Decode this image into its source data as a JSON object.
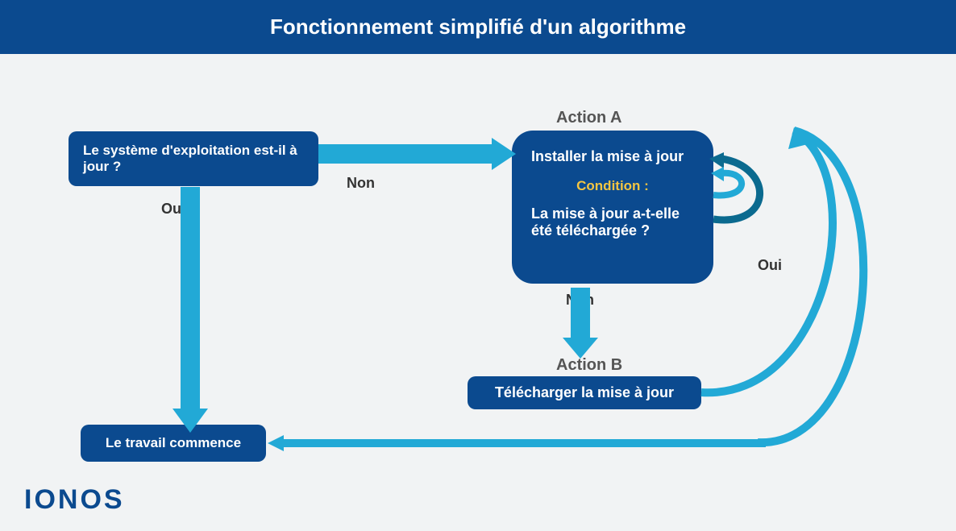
{
  "header": {
    "title": "Fonctionnement simplifié d'un algorithme"
  },
  "nodes": {
    "question": "Le système d'exploitation est-il à jour ?",
    "actionA_label": "Action A",
    "actionA_line1": "Installer la mise à jour",
    "actionA_condition_label": "Condition :",
    "actionA_condition_text": "La mise à jour a-t-elle été téléchargée ?",
    "actionB_label": "Action B",
    "actionB_text": "Télécharger la mise à jour",
    "result": "Le travail commence"
  },
  "edges": {
    "yes": "Oui",
    "no": "Non",
    "no2": "Non",
    "yes_loop": "Oui"
  },
  "brand": "IONOS",
  "colors": {
    "primary": "#0b4a8f",
    "arrow": "#22a9d6",
    "accent": "#f4c542"
  }
}
